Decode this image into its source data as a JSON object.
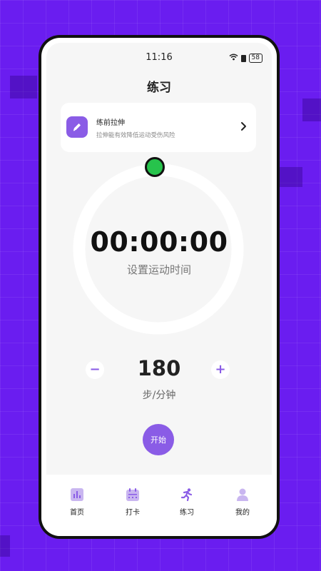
{
  "status_bar": {
    "time": "11:16",
    "battery": "58"
  },
  "page_title": "练习",
  "stretch_card": {
    "title": "练前拉伸",
    "subtitle": "拉伸能有效降低运动受伤风险"
  },
  "timer": {
    "display": "00:00:00",
    "subtitle": "设置运动时间",
    "progress": 0
  },
  "cadence": {
    "value": "180",
    "unit": "步/分钟",
    "minus": "−",
    "plus": "+"
  },
  "start_button": "开始",
  "tabs": [
    {
      "label": "首页",
      "icon": "chart-icon",
      "active": false
    },
    {
      "label": "打卡",
      "icon": "calendar-icon",
      "active": false
    },
    {
      "label": "练习",
      "icon": "runner-icon",
      "active": true
    },
    {
      "label": "我的",
      "icon": "person-icon",
      "active": false
    }
  ],
  "colors": {
    "accent": "#8a5ce6",
    "handle": "#27c34c",
    "background": "#6a1df0"
  }
}
